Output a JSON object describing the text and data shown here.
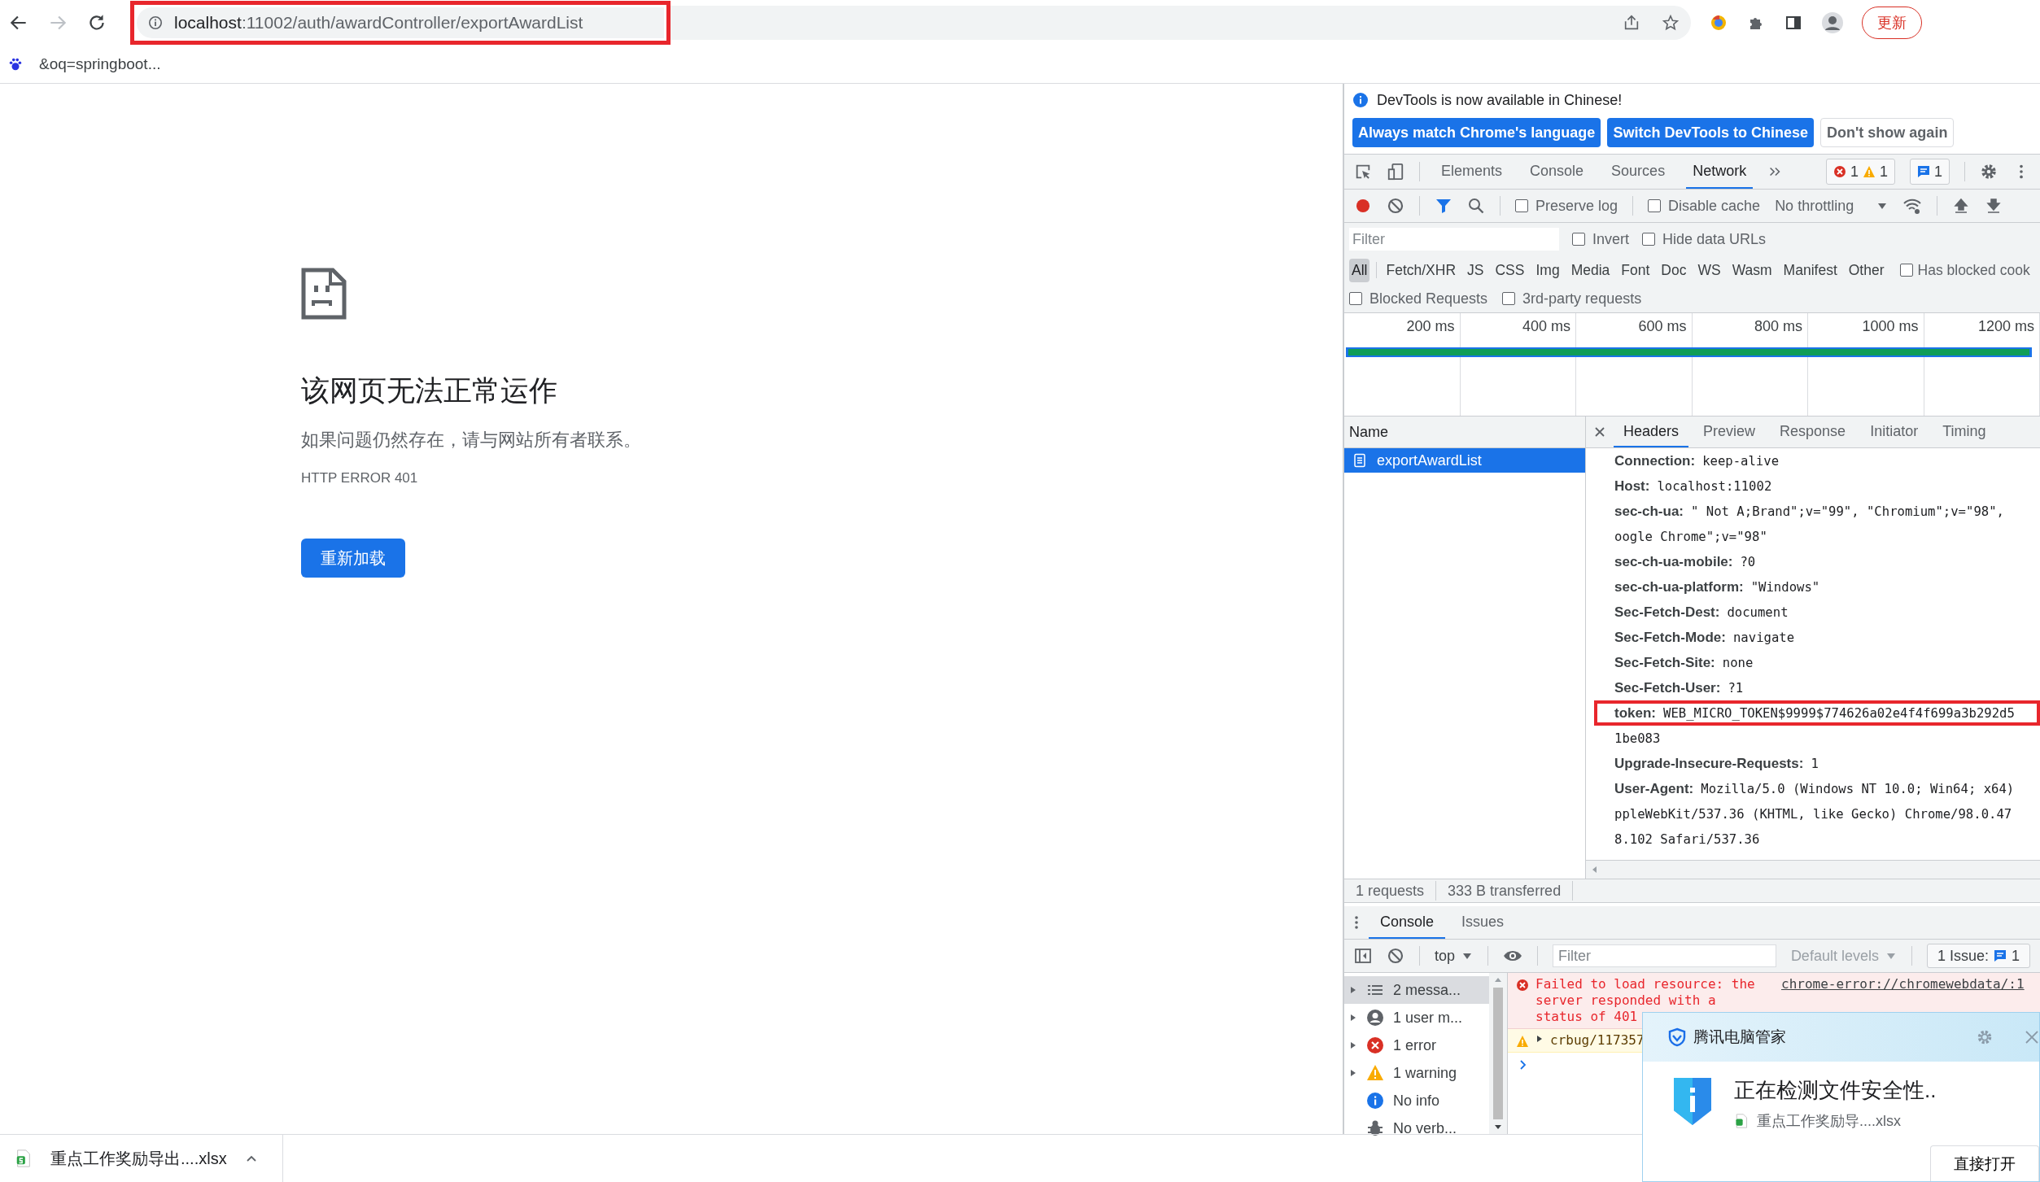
{
  "browser": {
    "nav": [
      {
        "kind": "back",
        "disabled": false
      },
      {
        "kind": "forward",
        "disabled": true
      },
      {
        "kind": "reload",
        "disabled": false
      }
    ],
    "address": {
      "host": "localhost",
      "path": ":11002/auth/awardController/exportAwardList",
      "highlighted": true
    },
    "update_button": "更新",
    "bookmarks": [
      {
        "label": "&oq=springboot..."
      }
    ]
  },
  "error_page": {
    "title": "该网页无法正常运作",
    "message": "如果问题仍然存在，请与网站所有者联系。",
    "code": "HTTP ERROR 401",
    "reload_button": "重新加载"
  },
  "devtools": {
    "banner": {
      "text": "DevTools is now available in Chinese!",
      "buttons": [
        {
          "label": "Always match Chrome's language",
          "kind": "primary"
        },
        {
          "label": "Switch DevTools to Chinese",
          "kind": "primary"
        },
        {
          "label": "Don't show again",
          "kind": "secondary"
        }
      ]
    },
    "tabs": [
      {
        "label": "Elements",
        "selected": false
      },
      {
        "label": "Console",
        "selected": false
      },
      {
        "label": "Sources",
        "selected": false
      },
      {
        "label": "Network",
        "selected": true
      }
    ],
    "counters": {
      "errors": "1",
      "warnings": "1",
      "messages": "1"
    },
    "toolbar": {
      "recording": true,
      "checks": [
        {
          "label": "Preserve log",
          "checked": false
        },
        {
          "label": "Disable cache",
          "checked": false
        }
      ],
      "throttling": "No throttling"
    },
    "filter": {
      "placeholder": "Filter",
      "checks": [
        {
          "label": "Invert",
          "checked": false
        },
        {
          "label": "Hide data URLs",
          "checked": false
        }
      ]
    },
    "types": [
      {
        "label": "All",
        "selected": true
      },
      {
        "label": "Fetch/XHR",
        "selected": false
      },
      {
        "label": "JS",
        "selected": false
      },
      {
        "label": "CSS",
        "selected": false
      },
      {
        "label": "Img",
        "selected": false
      },
      {
        "label": "Media",
        "selected": false
      },
      {
        "label": "Font",
        "selected": false
      },
      {
        "label": "Doc",
        "selected": false
      },
      {
        "label": "WS",
        "selected": false
      },
      {
        "label": "Wasm",
        "selected": false
      },
      {
        "label": "Manifest",
        "selected": false
      },
      {
        "label": "Other",
        "selected": false
      }
    ],
    "blocked_cookies": {
      "label": "Has blocked cook",
      "checked": false
    },
    "extra_checks": [
      {
        "label": "Blocked Requests",
        "checked": false
      },
      {
        "label": "3rd-party requests",
        "checked": false
      }
    ],
    "timeline": {
      "ticks": [
        "200 ms",
        "400 ms",
        "600 ms",
        "800 ms",
        "1000 ms",
        "1200 ms"
      ]
    },
    "requests": {
      "header": "Name",
      "rows": [
        {
          "name": "exportAwardList",
          "selected": true
        }
      ]
    },
    "detail_tabs": [
      {
        "label": "Headers",
        "selected": true
      },
      {
        "label": "Preview",
        "selected": false
      },
      {
        "label": "Response",
        "selected": false
      },
      {
        "label": "Initiator",
        "selected": false
      },
      {
        "label": "Timing",
        "selected": false
      }
    ],
    "headers": [
      {
        "name": "Connection:",
        "lines": [
          "keep-alive"
        ],
        "highlighted": false
      },
      {
        "name": "Host:",
        "lines": [
          "localhost:11002"
        ],
        "highlighted": false
      },
      {
        "name": "sec-ch-ua:",
        "lines": [
          "\" Not A;Brand\";v=\"99\", \"Chromium\";v=\"98\",",
          "oogle Chrome\";v=\"98\""
        ],
        "highlighted": false
      },
      {
        "name": "sec-ch-ua-mobile:",
        "lines": [
          "?0"
        ],
        "highlighted": false
      },
      {
        "name": "sec-ch-ua-platform:",
        "lines": [
          "\"Windows\""
        ],
        "highlighted": false
      },
      {
        "name": "Sec-Fetch-Dest:",
        "lines": [
          "document"
        ],
        "highlighted": false
      },
      {
        "name": "Sec-Fetch-Mode:",
        "lines": [
          "navigate"
        ],
        "highlighted": false
      },
      {
        "name": "Sec-Fetch-Site:",
        "lines": [
          "none"
        ],
        "highlighted": false
      },
      {
        "name": "Sec-Fetch-User:",
        "lines": [
          "?1"
        ],
        "highlighted": false
      },
      {
        "name": "token:",
        "lines": [
          "WEB_MICRO_TOKEN$9999$774626a02e4f4f699a3b292d5",
          "1be083"
        ],
        "highlighted": true
      },
      {
        "name": "Upgrade-Insecure-Requests:",
        "lines": [
          "1"
        ],
        "highlighted": false
      },
      {
        "name": "User-Agent:",
        "lines": [
          "Mozilla/5.0 (Windows NT 10.0; Win64; x64)",
          "ppleWebKit/537.36 (KHTML, like Gecko) Chrome/98.0.47",
          "8.102 Safari/537.36"
        ],
        "highlighted": false
      }
    ],
    "summary": [
      "1 requests",
      "333 B transferred"
    ],
    "drawer": {
      "tabs": [
        {
          "label": "Console",
          "selected": true
        },
        {
          "label": "Issues",
          "selected": false
        }
      ],
      "context": "top",
      "filter_placeholder": "Filter",
      "levels": "Default levels",
      "issues_label": "1 Issue:",
      "issues_count": "1",
      "sidebar": [
        {
          "label": "2 messa...",
          "kind": "messages",
          "selected": true,
          "expandable": true
        },
        {
          "label": "1 user m...",
          "kind": "user",
          "selected": false,
          "expandable": true
        },
        {
          "label": "1 error",
          "kind": "error",
          "selected": false,
          "expandable": true
        },
        {
          "label": "1 warning",
          "kind": "warning",
          "selected": false,
          "expandable": true
        },
        {
          "label": "No info",
          "kind": "info",
          "selected": false,
          "expandable": false
        },
        {
          "label": "No verb...",
          "kind": "verbose",
          "selected": false,
          "expandable": false
        }
      ],
      "messages": [
        {
          "kind": "error",
          "text": "Failed to load resource: the server responded with a status of 401",
          "source": "chrome-error://chromewebdata/:1"
        },
        {
          "kind": "warning",
          "text": "crbug/117357"
        }
      ]
    }
  },
  "downloads": [
    {
      "name": "重点工作奖励导出....xlsx"
    }
  ],
  "security_popup": {
    "title": "腾讯电脑管家",
    "status": "正在检测文件安全性..",
    "file": "重点工作奖励导....xlsx",
    "button": "直接打开"
  }
}
